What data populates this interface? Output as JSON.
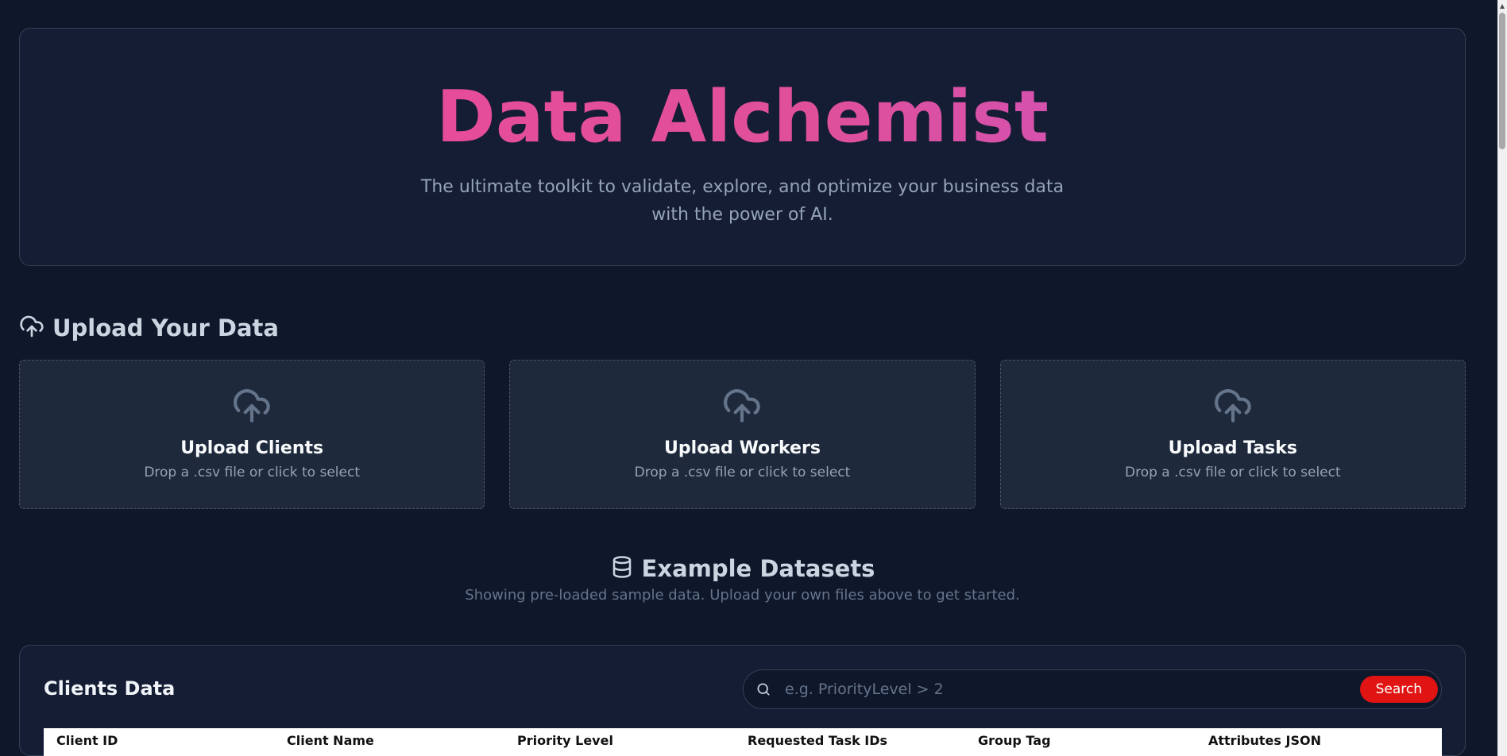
{
  "hero": {
    "title": "Data Alchemist",
    "subtitle": "The ultimate toolkit to validate, explore, and optimize your business data with the power of AI."
  },
  "upload_section": {
    "icon": "cloud-upload-icon",
    "title": "Upload Your Data",
    "cards": [
      {
        "icon": "cloud-upload-icon",
        "title": "Upload Clients",
        "subtitle": "Drop a .csv file or click to select"
      },
      {
        "icon": "cloud-upload-icon",
        "title": "Upload Workers",
        "subtitle": "Drop a .csv file or click to select"
      },
      {
        "icon": "cloud-upload-icon",
        "title": "Upload Tasks",
        "subtitle": "Drop a .csv file or click to select"
      }
    ]
  },
  "examples": {
    "icon": "database-icon",
    "title": "Example Datasets",
    "subtitle": "Showing pre-loaded sample data. Upload your own files above to get started."
  },
  "clients_panel": {
    "title": "Clients Data",
    "search": {
      "placeholder": "e.g. PriorityLevel > 2",
      "value": "",
      "button_label": "Search"
    },
    "columns": [
      "Client ID",
      "Client Name",
      "Priority Level",
      "Requested Task IDs",
      "Group Tag",
      "Attributes JSON"
    ]
  },
  "colors": {
    "background": "#0f172a",
    "card": "#1e293b",
    "accent_pink": "#ec4899",
    "accent_purple": "#c154d0",
    "search_button": "#e11414"
  }
}
